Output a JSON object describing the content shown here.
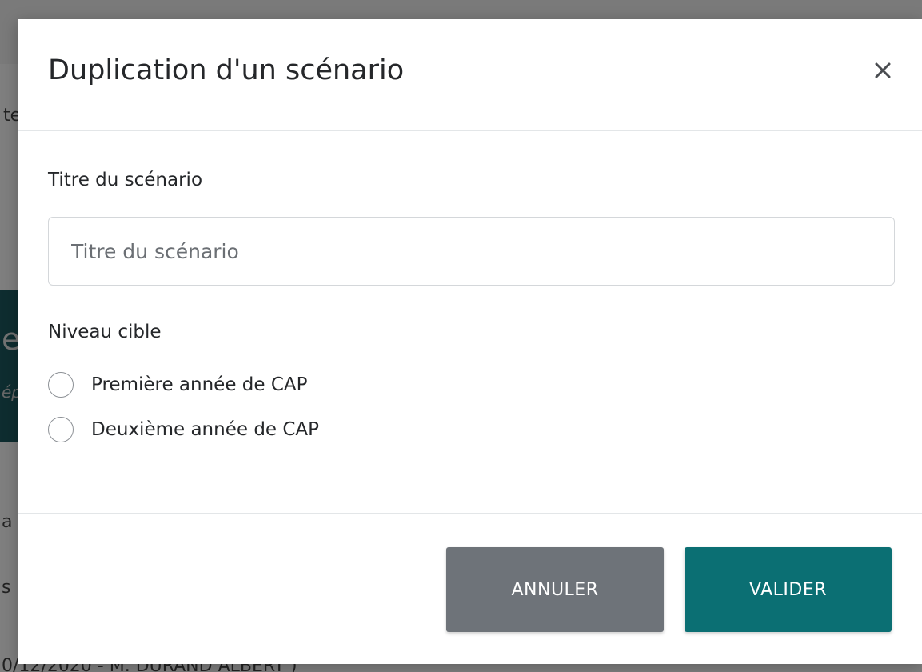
{
  "modal": {
    "title": "Duplication d'un scénario",
    "close_icon": "close-icon"
  },
  "form": {
    "title_label": "Titre du scénario",
    "title_input": {
      "value": "",
      "placeholder": "Titre du scénario"
    },
    "level_label": "Niveau cible",
    "level_options": [
      {
        "label": "Première année de CAP",
        "selected": false
      },
      {
        "label": "Deuxième année de CAP",
        "selected": false
      }
    ]
  },
  "actions": {
    "cancel_label": "ANNULER",
    "validate_label": "VALIDER"
  },
  "colors": {
    "validate_button": "#0b6f73",
    "cancel_button": "#6e7379",
    "overlay": "#7a7a7a"
  }
}
